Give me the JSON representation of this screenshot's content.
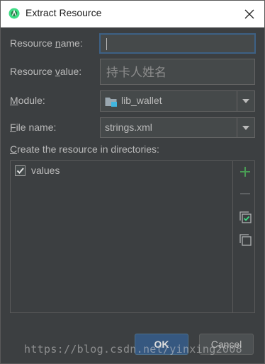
{
  "window": {
    "title": "Extract Resource"
  },
  "form": {
    "resource_name": {
      "label_pre": "Resource ",
      "label_mn": "n",
      "label_post": "ame:",
      "value": ""
    },
    "resource_value": {
      "label_pre": "Resource ",
      "label_mn": "v",
      "label_post": "alue:",
      "value": "持卡人姓名"
    },
    "module": {
      "label_pre": "",
      "label_mn": "M",
      "label_post": "odule:",
      "value": "lib_wallet"
    },
    "file_name": {
      "label_pre": "",
      "label_mn": "F",
      "label_post": "ile name:",
      "value": "strings.xml"
    },
    "directories_label": {
      "label_mn": "C",
      "label_post": "reate the resource in directories:"
    }
  },
  "directories": [
    {
      "label": "values",
      "checked": true
    }
  ],
  "buttons": {
    "ok": "OK",
    "cancel": "Cancel"
  },
  "watermark": "https://blog.csdn.net/yinxing2008",
  "colors": {
    "background": "#3c3f41",
    "field": "#45494a",
    "ok_button": "#365880",
    "add_icon": "#499c54",
    "text": "#bbbbbb"
  }
}
